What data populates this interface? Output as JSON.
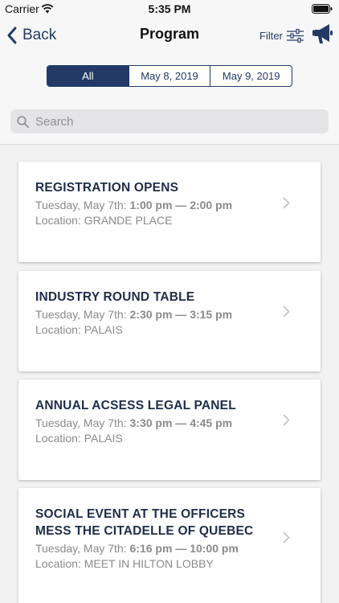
{
  "status_bar": {
    "carrier": "Carrier",
    "time": "5:35 PM"
  },
  "nav": {
    "back_label": "Back",
    "title": "Program",
    "filter_label": "Filter"
  },
  "segments": [
    {
      "label": "All",
      "active": true
    },
    {
      "label": "May 8, 2019",
      "active": false
    },
    {
      "label": "May 9, 2019",
      "active": false
    }
  ],
  "search": {
    "placeholder": "Search",
    "value": ""
  },
  "events": [
    {
      "title": "REGISTRATION OPENS",
      "day": "Tuesday, May 7th:",
      "time": "1:00 pm — 2:00 pm",
      "location": "Location: GRANDE PLACE"
    },
    {
      "title": "INDUSTRY ROUND TABLE",
      "day": "Tuesday, May 7th:",
      "time": "2:30 pm — 3:15 pm",
      "location": "Location: PALAIS"
    },
    {
      "title": "ANNUAL ACSESS LEGAL PANEL",
      "day": "Tuesday, May 7th:",
      "time": "3:30 pm — 4:45 pm",
      "location": "Location: PALAIS"
    },
    {
      "title": "SOCIAL EVENT AT THE OFFICERS MESS THE CITADELLE OF QUEBEC",
      "day": "Tuesday, May 7th:",
      "time": "6:16 pm — 10:00 pm",
      "location": "Location: MEET IN HILTON LOBBY"
    }
  ],
  "colors": {
    "brand": "#233a66",
    "muted_text": "#8a8a8a",
    "background": "#f7f7f7"
  }
}
